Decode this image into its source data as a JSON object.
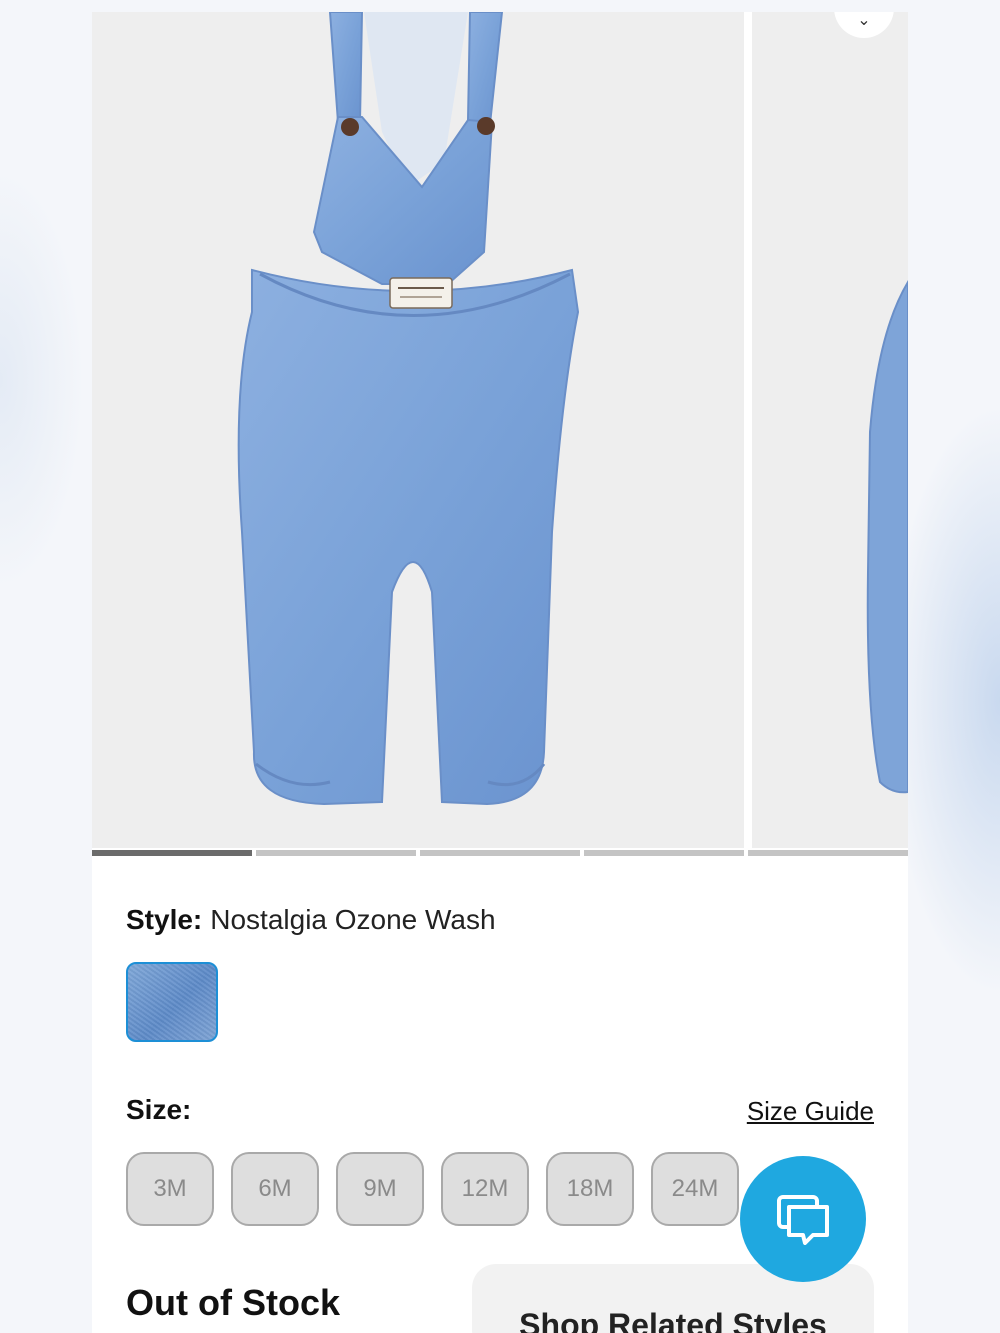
{
  "gallery": {
    "slide_count": 5,
    "active_index": 0,
    "favorite_icon": "chevron-down-icon"
  },
  "product": {
    "style_label": "Style:",
    "style_value": "Nostalgia Ozone Wash",
    "swatch_color": "#6f98d0",
    "size_label": "Size:",
    "size_guide": "Size Guide",
    "sizes": [
      "3M",
      "6M",
      "9M",
      "12M",
      "18M",
      "24M"
    ]
  },
  "status": {
    "out_of_stock": "Out of Stock",
    "related_button": "Shop Related Styles"
  },
  "chat": {
    "icon": "chat-bubble-icon",
    "color": "#1fa8e0"
  },
  "colors": {
    "denim": "#7ea4d8",
    "accent": "#1fa8e0",
    "disabled_bg": "#dedede"
  }
}
